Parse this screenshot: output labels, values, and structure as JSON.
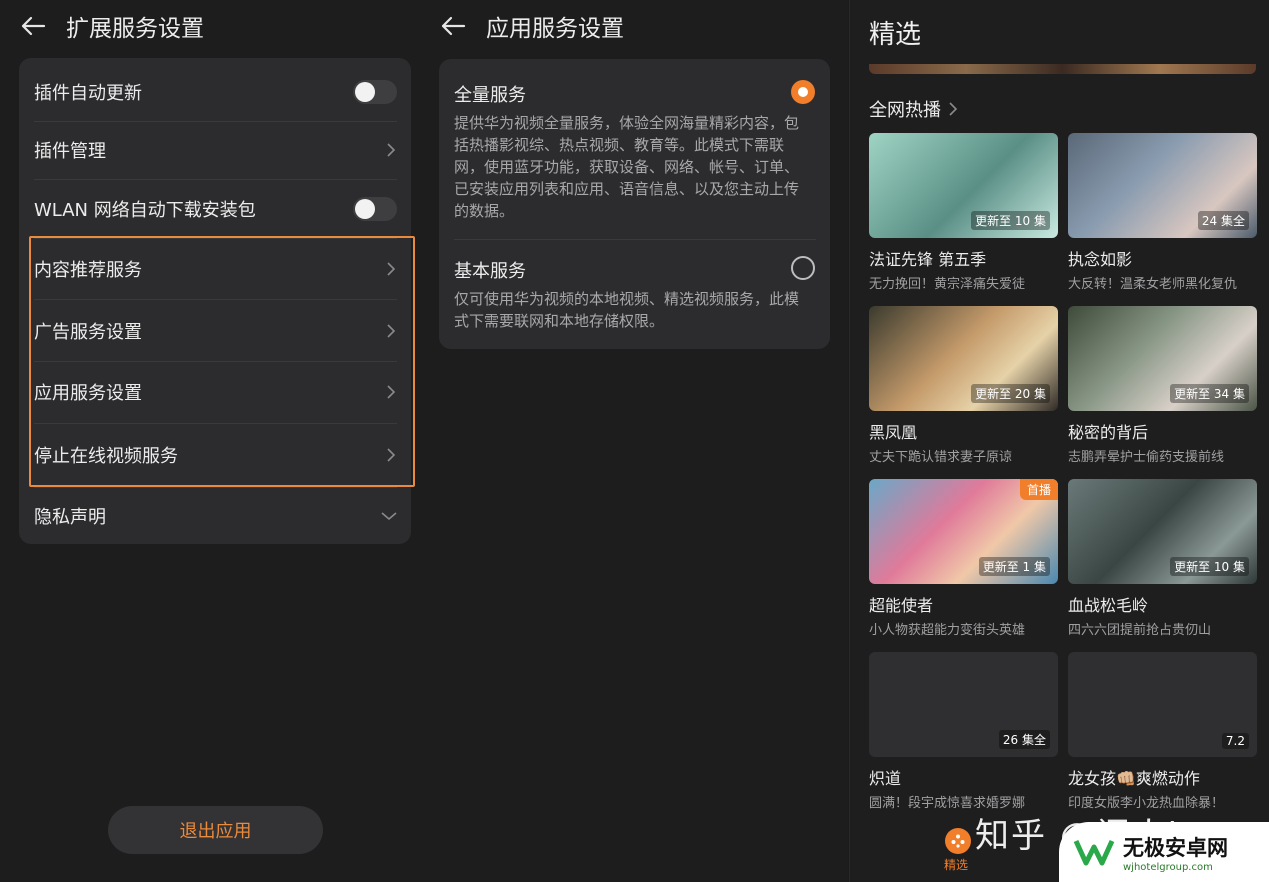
{
  "ext_settings": {
    "title": "扩展服务设置",
    "rows": [
      {
        "label": "插件自动更新",
        "type": "toggle"
      },
      {
        "label": "插件管理",
        "type": "nav"
      },
      {
        "label": "WLAN 网络自动下载安装包",
        "type": "toggle"
      },
      {
        "label": "内容推荐服务",
        "type": "nav"
      },
      {
        "label": "广告服务设置",
        "type": "nav"
      },
      {
        "label": "应用服务设置",
        "type": "nav"
      },
      {
        "label": "停止在线视频服务",
        "type": "nav"
      },
      {
        "label": "隐私声明",
        "type": "expand"
      }
    ],
    "exit_label": "退出应用",
    "accent": "#e98a3c"
  },
  "app_settings": {
    "title": "应用服务设置",
    "options": [
      {
        "title": "全量服务",
        "desc": "提供华为视频全量服务，体验全网海量精彩内容，包括热播影视综、热点视频、教育等。此模式下需联网，使用蓝牙功能，获取设备、网络、帐号、订单、已安装应用列表和应用、语音信息、以及您主动上传的数据。",
        "selected": true
      },
      {
        "title": "基本服务",
        "desc": "仅可使用华为视频的本地视频、精选视频服务，此模式下需要联网和本地存储权限。",
        "selected": false
      }
    ]
  },
  "featured": {
    "title": "精选",
    "section": "全网热播",
    "items": [
      {
        "name": "法证先锋 第五季",
        "sub": "无力挽回！黄宗泽痛失爱徒",
        "badge": "更新至 10 集",
        "top": ""
      },
      {
        "name": "执念如影",
        "sub": "大反转！温柔女老师黑化复仇",
        "badge": "24 集全",
        "top": ""
      },
      {
        "name": "黑凤凰",
        "sub": "丈夫下跪认错求妻子原谅",
        "badge": "更新至 20 集",
        "top": ""
      },
      {
        "name": "秘密的背后",
        "sub": "志鹏弄晕护士偷药支援前线",
        "badge": "更新至 34 集",
        "top": ""
      },
      {
        "name": "超能使者",
        "sub": "小人物获超能力变街头英雄",
        "badge": "更新至 1 集",
        "top": "首播"
      },
      {
        "name": "血战松毛岭",
        "sub": "四六六团提前抢占贵仞山",
        "badge": "更新至 10 集",
        "top": ""
      },
      {
        "name": "炽道",
        "sub": "圆满！段宇成惊喜求婚罗娜",
        "badge": "26 集全",
        "top": ""
      },
      {
        "name": "龙女孩👊🏼爽燃动作",
        "sub": "印度女版李小龙热血除暴！",
        "badge": "7.2",
        "top": ""
      }
    ],
    "nav_label": "精选",
    "watermark": "知乎 @闲人bot",
    "site_name": "无极安卓网",
    "site_url": "wjhotelgroup.com",
    "accent": "#f07e2a"
  }
}
